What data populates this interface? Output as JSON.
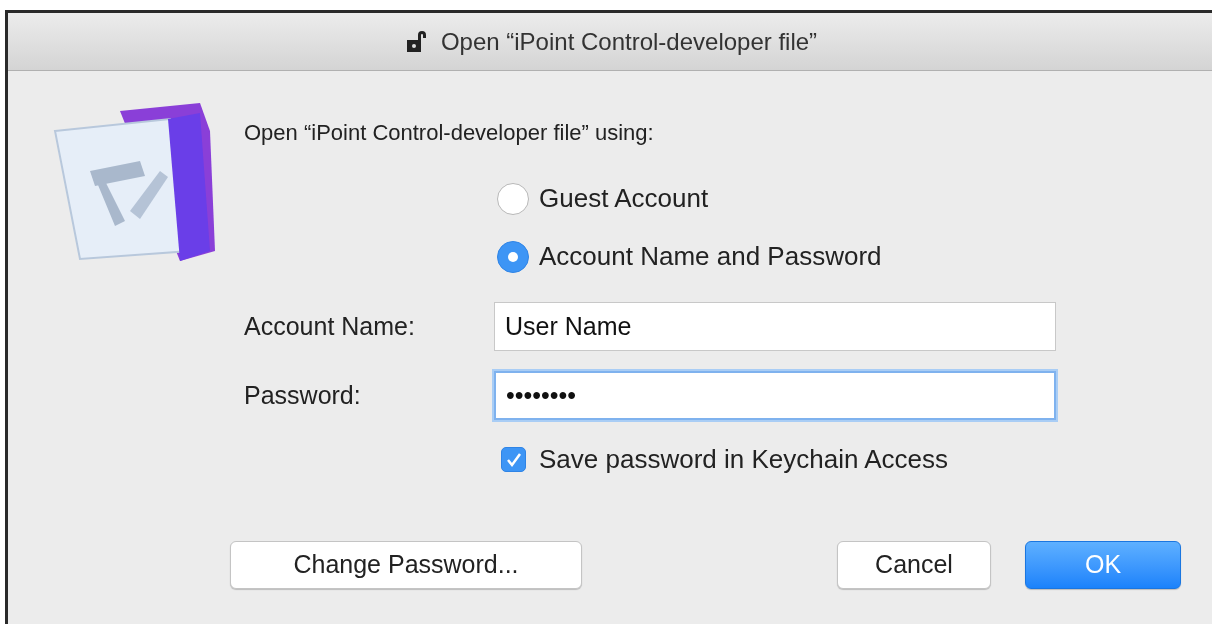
{
  "window": {
    "title": "Open “iPoint Control-developer file”"
  },
  "prompt": "Open “iPoint Control-developer file” using:",
  "login_options": [
    {
      "label": "Guest Account",
      "selected": false
    },
    {
      "label": "Account Name and Password",
      "selected": true
    }
  ],
  "fields": [
    {
      "label": "Account Name:",
      "value": "User Name",
      "focused": false
    },
    {
      "label": "Password:",
      "value": "••••••••",
      "focused": true
    }
  ],
  "save_password": {
    "label": "Save password in Keychain Access",
    "checked": true
  },
  "buttons": [
    {
      "label": "Change Password...",
      "kind": "secondary"
    },
    {
      "label": "Cancel",
      "kind": "secondary"
    },
    {
      "label": "OK",
      "kind": "default"
    }
  ]
}
